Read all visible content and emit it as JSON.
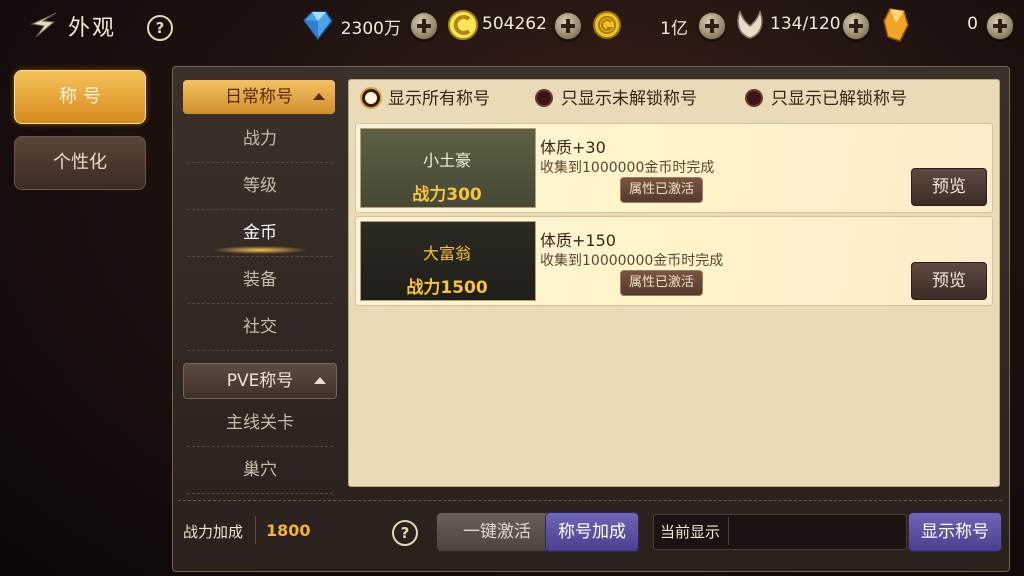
{
  "header": {
    "title": "外观",
    "help_symbol": "?",
    "resources": [
      {
        "icon": "diamond-icon",
        "value": "2300万"
      },
      {
        "icon": "coin-c-icon",
        "value": "504262"
      },
      {
        "icon": "gold-g-icon",
        "value": "1亿"
      },
      {
        "icon": "wing-icon",
        "value": "134/120"
      },
      {
        "icon": "crystal-icon",
        "value": "0"
      }
    ]
  },
  "side_tabs": [
    {
      "label": "称 号",
      "active": true
    },
    {
      "label": "个性化",
      "active": false
    }
  ],
  "categories": [
    {
      "label": "日常称号",
      "items": [
        "战力",
        "等级",
        "金币",
        "装备",
        "社交"
      ],
      "selected": "金币"
    },
    {
      "label": "PVE称号",
      "items": [
        "主线关卡",
        "巢穴"
      ]
    }
  ],
  "filters": [
    {
      "label": "显示所有称号",
      "selected": true
    },
    {
      "label": "只显示未解锁称号",
      "selected": false
    },
    {
      "label": "只显示已解锁称号",
      "selected": false
    }
  ],
  "titles": [
    {
      "name": "小土豪",
      "power": "战力300",
      "attribute": "体质+30",
      "condition": "收集到1000000金币时完成",
      "status": "属性已激活",
      "preview": "预览"
    },
    {
      "name": "大富翁",
      "power": "战力1500",
      "attribute": "体质+150",
      "condition": "收集到10000000金币时完成",
      "status": "属性已激活",
      "preview": "预览"
    }
  ],
  "footer": {
    "power_label": "战力加成",
    "power_value": "1800",
    "help_symbol": "?",
    "activate_all": "一键激活",
    "title_bonus": "称号加成",
    "current_display_label": "当前显示",
    "current_display_value": "",
    "show_title": "显示称号"
  },
  "colors": {
    "accent_gold": "#f2b33c",
    "button_purple": "#5a4fa3",
    "active_tab": "#e9a53a"
  }
}
